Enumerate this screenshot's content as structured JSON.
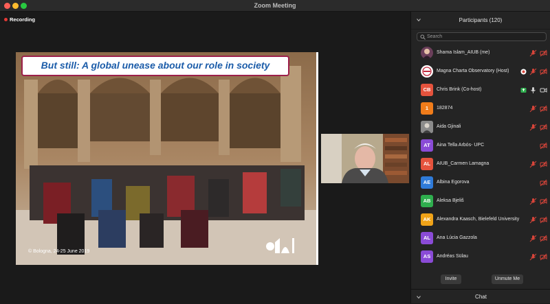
{
  "window": {
    "title": "Zoom Meeting"
  },
  "recording": {
    "label": "Recording"
  },
  "slide": {
    "banner": "But still: A global unease about our role in society",
    "caption": "© Bologna, 24-25 June 2019"
  },
  "participants": {
    "header": "Participants (120)",
    "search_placeholder": "Search",
    "list": [
      {
        "name": "Shama Islam_AIUB (me)",
        "avatar": "",
        "color": "#6b3f5a"
      },
      {
        "name": "Magna Charta Observatory (Host)",
        "avatar": "",
        "color": "#ffffff"
      },
      {
        "name": "Chris Brink (Co-host)",
        "avatar": "CB",
        "color": "#e5533d"
      },
      {
        "name": "182874",
        "avatar": "1",
        "color": "#f07c1a"
      },
      {
        "name": "Aida Gjinali",
        "avatar": "",
        "color": "#7a7a7a"
      },
      {
        "name": "Aina Tella Arbós- UPC",
        "avatar": "AT",
        "color": "#8a4bd6"
      },
      {
        "name": "AIUB_Carmen Lamagna",
        "avatar": "AL",
        "color": "#e5533d"
      },
      {
        "name": "Albina Egorova",
        "avatar": "AE",
        "color": "#2f7bd9"
      },
      {
        "name": "Aleksa Bjeliš",
        "avatar": "AB",
        "color": "#2fae4e"
      },
      {
        "name": "Alexandra Kaasch, Bielefeld University",
        "avatar": "AK",
        "color": "#f0a318"
      },
      {
        "name": "Ana Lúcia Gazzola",
        "avatar": "AL",
        "color": "#8a4bd6"
      },
      {
        "name": "Andréas Sülau",
        "avatar": "AS",
        "color": "#8a4bd6"
      }
    ],
    "invite_label": "Invite",
    "unmute_me_label": "Unmute Me",
    "chat_label": "Chat"
  },
  "colors": {
    "banner_border": "#9c1f4a",
    "banner_text": "#1b5ca9",
    "muted_icon": "#d9453a"
  }
}
